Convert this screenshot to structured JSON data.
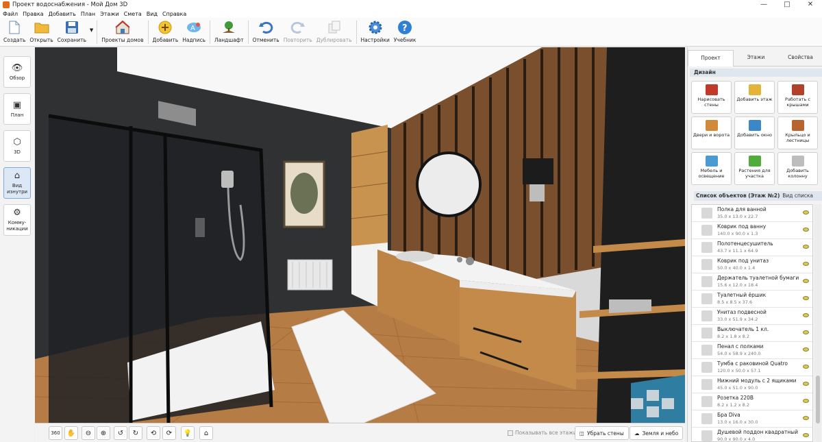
{
  "window": {
    "title": "Проект водоснабжения - Мой Дом 3D",
    "controls": [
      "—",
      "□",
      "✕"
    ]
  },
  "menu": [
    "Файл",
    "Правка",
    "Добавить",
    "План",
    "Этажи",
    "Смета",
    "Вид",
    "Справка"
  ],
  "toolbar": {
    "items": [
      {
        "label": "Создать",
        "icon": "new-file-icon"
      },
      {
        "label": "Открыть",
        "icon": "folder-icon"
      },
      {
        "label": "Сохранить",
        "icon": "floppy-icon"
      },
      {
        "label": "Проекты домов",
        "icon": "house-icon"
      },
      {
        "label": "Добавить",
        "icon": "plus-icon"
      },
      {
        "label": "Надпись",
        "icon": "text-icon"
      },
      {
        "label": "Ландшафт",
        "icon": "tree-icon"
      },
      {
        "label": "Отменить",
        "icon": "undo-icon"
      },
      {
        "label": "Повторить",
        "icon": "redo-icon",
        "disabled": true
      },
      {
        "label": "Дублировать",
        "icon": "duplicate-icon",
        "disabled": true
      },
      {
        "label": "Настройки",
        "icon": "gear-icon"
      },
      {
        "label": "Учебник",
        "icon": "help-icon"
      }
    ]
  },
  "left_nav": [
    {
      "label": "Обзор",
      "icon": "eye-icon"
    },
    {
      "label": "План",
      "icon": "plan-icon"
    },
    {
      "label": "3D",
      "icon": "cube-icon"
    },
    {
      "label": "Вид изнутри",
      "icon": "inside-view-icon",
      "active": true
    },
    {
      "label": "Комму-никации",
      "icon": "pipes-icon"
    }
  ],
  "bottom": {
    "show_all_floors": "Показывать все этажи",
    "remove_walls": "Убрать стены",
    "ground_sky": "Земля и небо"
  },
  "right_panel": {
    "tabs": [
      "Проект",
      "Этажи",
      "Свойства"
    ],
    "design_header": "Дизайн",
    "design_buttons": [
      {
        "label": "Нарисовать стены",
        "color": "#c0392b"
      },
      {
        "label": "Добавить этаж",
        "color": "#e4b43a"
      },
      {
        "label": "Работать с крышами",
        "color": "#b2412c"
      },
      {
        "label": "Двери и ворота",
        "color": "#d08a3a"
      },
      {
        "label": "Добавить окно",
        "color": "#3a88c8"
      },
      {
        "label": "Крыльцо и лестницы",
        "color": "#b5652d"
      },
      {
        "label": "Мебель и освещение",
        "color": "#4a9ad4"
      },
      {
        "label": "Растения для участка",
        "color": "#4fae3a"
      },
      {
        "label": "Добавить колонну",
        "color": "#bdbdbd"
      }
    ],
    "list_header": "Список объектов (Этаж №2)",
    "list_view": "Вид списка",
    "objects": [
      {
        "name": "Полка для ванной",
        "dims": "35.0 x 13.0 x 22.7"
      },
      {
        "name": "Коврик под ванну",
        "dims": "140.0 x 90.0 x 1.3"
      },
      {
        "name": "Полотенцесушитель",
        "dims": "43.7 x 11.1 x 64.9"
      },
      {
        "name": "Коврик под унитаз",
        "dims": "50.0 x 40.0 x 1.4"
      },
      {
        "name": "Держатель туалетной бумаги",
        "dims": "15.6 x 12.0 x 18.4"
      },
      {
        "name": "Туалетный ёршик",
        "dims": "8.5 x 8.5 x 37.6"
      },
      {
        "name": "Унитаз подвесной",
        "dims": "33.0 x 51.9 x 34.2"
      },
      {
        "name": "Выключатель 1 кл.",
        "dims": "8.2 x 1.8 x 8.2"
      },
      {
        "name": "Пенал с полками",
        "dims": "54.0 x 58.9 x 240.0"
      },
      {
        "name": "Тумба с раковиной Quatro",
        "dims": "120.0 x 50.0 x 57.1"
      },
      {
        "name": "Нижний модуль с 2 ящиками",
        "dims": "45.0 x 51.0 x 90.0"
      },
      {
        "name": "Розетка 220В",
        "dims": "8.2 x 1.2 x 8.2"
      },
      {
        "name": "Бра Diva",
        "dims": "13.0 x 16.0 x 30.0"
      },
      {
        "name": "Душевой поддон квадратный",
        "dims": "90.0 x 90.0 x 4.0"
      }
    ]
  }
}
